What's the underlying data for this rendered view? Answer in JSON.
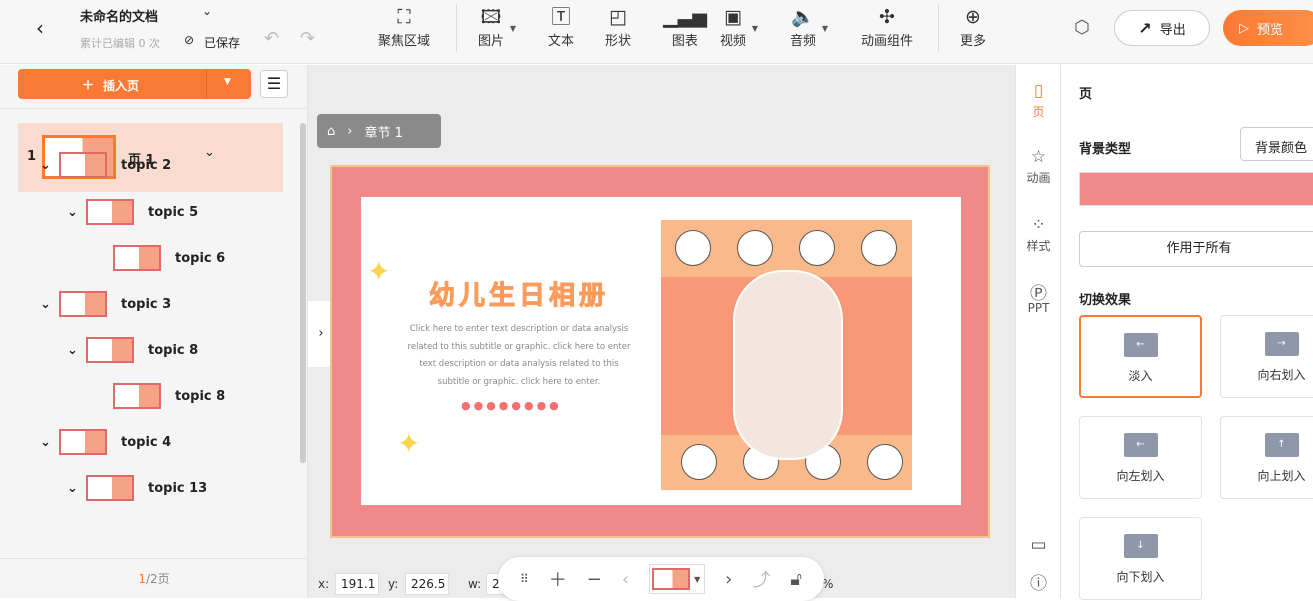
{
  "header": {
    "doc_title": "未命名的文档",
    "edit_count": "累计已编辑 0 次",
    "save_status": "已保存",
    "tools": [
      {
        "label": "聚焦区域",
        "icon": "focus-icon"
      },
      {
        "label": "图片",
        "icon": "image-icon"
      },
      {
        "label": "文本",
        "icon": "text-icon"
      },
      {
        "label": "形状",
        "icon": "shape-icon"
      },
      {
        "label": "图表",
        "icon": "chart-icon"
      },
      {
        "label": "视频",
        "icon": "video-icon"
      },
      {
        "label": "音频",
        "icon": "audio-icon"
      },
      {
        "label": "动画组件",
        "icon": "puzzle-icon"
      },
      {
        "label": "更多",
        "icon": "plus-circle-icon"
      }
    ],
    "export_label": "导出",
    "preview_label": "预览",
    "accent": "#fb7a33"
  },
  "left": {
    "insert_label": "插入页",
    "page_row": {
      "num": "1",
      "label": "页 1"
    },
    "items": [
      {
        "label": "topic 2",
        "level": 1
      },
      {
        "label": "topic 5",
        "level": 2
      },
      {
        "label": "topic 6",
        "level": 3
      },
      {
        "label": "topic 3",
        "level": 1
      },
      {
        "label": "topic 8",
        "level": 2
      },
      {
        "label": "topic 8",
        "level": 3
      },
      {
        "label": "topic 4",
        "level": 1
      },
      {
        "label": "topic 13",
        "level": 2
      }
    ],
    "pager_current": "1",
    "pager_total": "/2页"
  },
  "canvas": {
    "breadcrumb": "章节 1",
    "slide_title": "幼儿生日相册",
    "slide_body": "Click here to enter text description or data analysis related to this subtitle or graphic. click here to enter text description or data analysis related to this subtitle or graphic. click here to enter.",
    "frame_color": "#ee8a8a"
  },
  "coords": {
    "x_label": "x:",
    "x": "191.1",
    "y_label": "y:",
    "y": "226.5",
    "w_label": "w:",
    "w": "2",
    "pct": "%"
  },
  "rail": [
    {
      "label": "页",
      "icon": "page-icon"
    },
    {
      "label": "动画",
      "icon": "star-icon"
    },
    {
      "label": "样式",
      "icon": "style-icon"
    },
    {
      "label": "PPT",
      "icon": "ppt-icon"
    }
  ],
  "right": {
    "title": "页",
    "bg_type_label": "背景类型",
    "bg_type_value": "背景颜色",
    "bg_color": "#ee8a8a",
    "apply_all": "作用于所有",
    "transition_label": "切换效果",
    "effects": [
      "淡入",
      "向右划入",
      "向左划入",
      "向上划入",
      "向下划入"
    ],
    "selected_effect": "淡入"
  }
}
